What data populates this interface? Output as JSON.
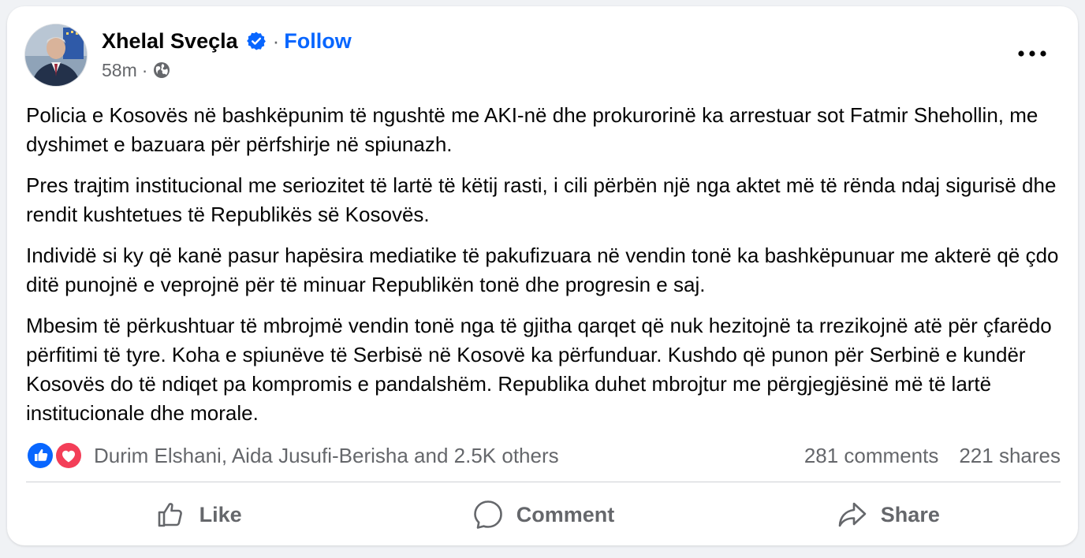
{
  "post": {
    "author": "Xhelal Sveçla",
    "follow_label": "Follow",
    "separator": "·",
    "timestamp": "58m",
    "audience_icon": "globe-icon",
    "more_icon": "more-options-icon",
    "verified_icon": "verified-badge-icon",
    "paragraphs": [
      "Policia e Kosovës në bashkëpunim të ngushtë me AKI-në dhe prokurorinë ka arrestuar sot Fatmir Shehollin, me dyshimet e bazuara për përfshirje në spiunazh.",
      "Pres trajtim institucional me seriozitet të lartë të këtij rasti, i cili përbën një nga aktet më të rënda ndaj sigurisë dhe rendit kushtetues të Republikës së Kosovës.",
      "Individë si ky që kanë pasur hapësira mediatike të pakufizuara në vendin tonë ka bashkëpunuar me akterë që çdo ditë punojnë e veprojnë për të minuar Republikën tonë dhe progresin e saj.",
      "Mbesim të përkushtuar të mbrojmë vendin tonë nga të gjitha qarqet që nuk hezitojnë ta rrezikojnë atë për çfarëdo përfitimi të tyre. Koha e spiunëve të Serbisë në Kosovë ka përfunduar. Kushdo që punon për Serbinë e kundër Kosovës do të ndiqet pa kompromis e pandalshëm. Republika duhet mbrojtur me përgjegjësinë më të lartë institucionale dhe morale."
    ]
  },
  "engagement": {
    "reaction_icons": [
      "like-reaction-icon",
      "love-reaction-icon"
    ],
    "reactors": "Durim Elshani, Aida Jusufi-Berisha and 2.5K others",
    "comments": "281 comments",
    "shares": "221 shares"
  },
  "actions": {
    "like": "Like",
    "comment": "Comment",
    "share": "Share"
  },
  "colors": {
    "background": "#f0f2f5",
    "card": "#ffffff",
    "text": "#050505",
    "secondary_text": "#65676b",
    "link_blue": "#0866ff",
    "verified_blue": "#0866ff",
    "like_blue": "#0866ff",
    "love_red": "#f33e58",
    "divider": "#ced0d4"
  }
}
